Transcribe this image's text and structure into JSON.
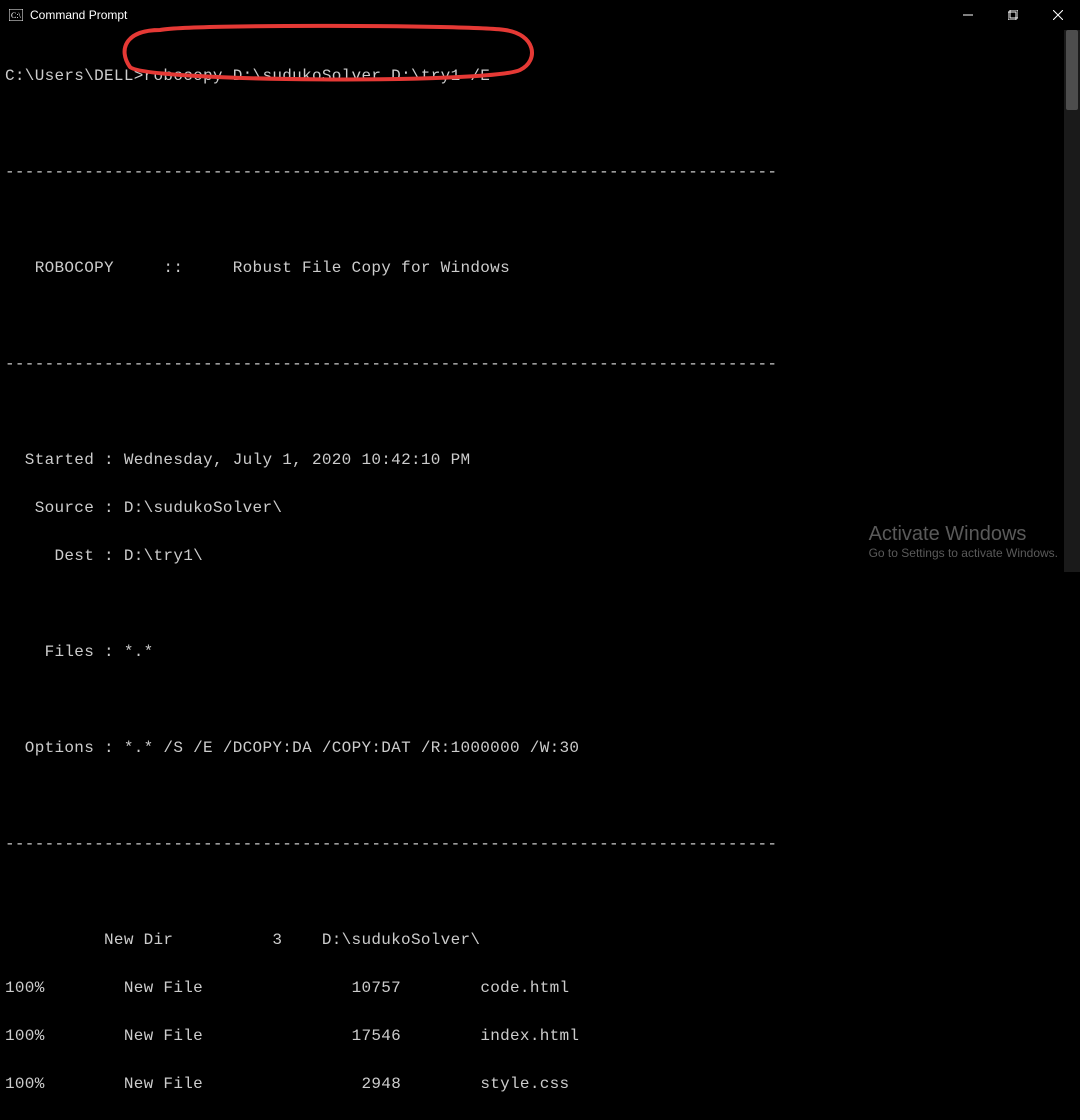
{
  "window": {
    "title": "Command Prompt"
  },
  "cmd": {
    "prompt": "C:\\Users\\DELL>",
    "command": "robocopy D:\\sudukoSolver D:\\try1 /E"
  },
  "robocopy": {
    "banner_line": "   ROBOCOPY     ::     Robust File Copy for Windows",
    "started_label": "  Started : ",
    "started_value": "Wednesday, July 1, 2020 10:42:10 PM",
    "source_label": "   Source : ",
    "source_value": "D:\\sudukoSolver\\",
    "dest_label": "     Dest : ",
    "dest_value": "D:\\try1\\",
    "files_label": "    Files : ",
    "files_value": "*.*",
    "options_label": "  Options : ",
    "options_value": "*.* /S /E /DCOPY:DA /COPY:DAT /R:1000000 /W:30"
  },
  "listing": {
    "newdir_line": "          New Dir          3    D:\\sudukoSolver\\",
    "rows": [
      {
        "pct": "100%",
        "type": "New File",
        "size": "10757",
        "name": "code.html"
      },
      {
        "pct": "100%",
        "type": "New File",
        "size": "17546",
        "name": "index.html"
      },
      {
        "pct": "100%",
        "type": "New File",
        "size": "2948",
        "name": "style.css"
      }
    ]
  },
  "dashline": "------------------------------------------------------------------------------",
  "watermark": {
    "title": "Activate Windows",
    "sub": "Go to Settings to activate Windows."
  }
}
